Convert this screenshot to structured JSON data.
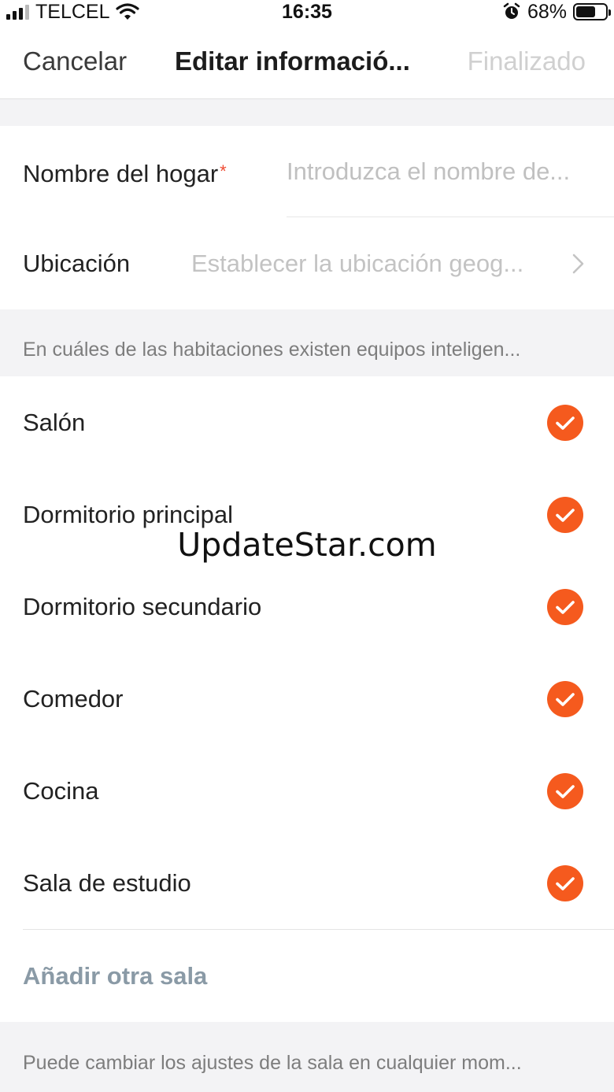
{
  "status_bar": {
    "carrier": "TELCEL",
    "time": "16:35",
    "battery_percent": "68%",
    "battery_level": 0.68,
    "icons": [
      "signal-icon",
      "wifi-icon",
      "alarm-icon",
      "battery-icon"
    ]
  },
  "nav": {
    "cancel_label": "Cancelar",
    "title": "Editar informació...",
    "done_label": "Finalizado"
  },
  "form": {
    "name_label": "Nombre del hogar",
    "required_mark": "*",
    "name_placeholder": "Introduzca el nombre de...",
    "name_value": "",
    "location_label": "Ubicación",
    "location_value": "Establecer la ubicación geog..."
  },
  "rooms_hint": "En cuáles de las habitaciones existen equipos inteligen...",
  "rooms": [
    {
      "label": "Salón",
      "checked": true
    },
    {
      "label": "Dormitorio principal",
      "checked": true
    },
    {
      "label": "Dormitorio secundario",
      "checked": true
    },
    {
      "label": "Comedor",
      "checked": true
    },
    {
      "label": "Cocina",
      "checked": true
    },
    {
      "label": "Sala de estudio",
      "checked": true
    }
  ],
  "add_room_label": "Añadir otra sala",
  "footer_hint": "Puede cambiar los ajustes de la sala en cualquier mom...",
  "watermark": "UpdateStar.com",
  "colors": {
    "accent": "#f55a1e",
    "required": "#ef4b33",
    "placeholder": "#c0c0c0",
    "add_room": "#8a9aa6",
    "background": "#f3f3f5"
  }
}
